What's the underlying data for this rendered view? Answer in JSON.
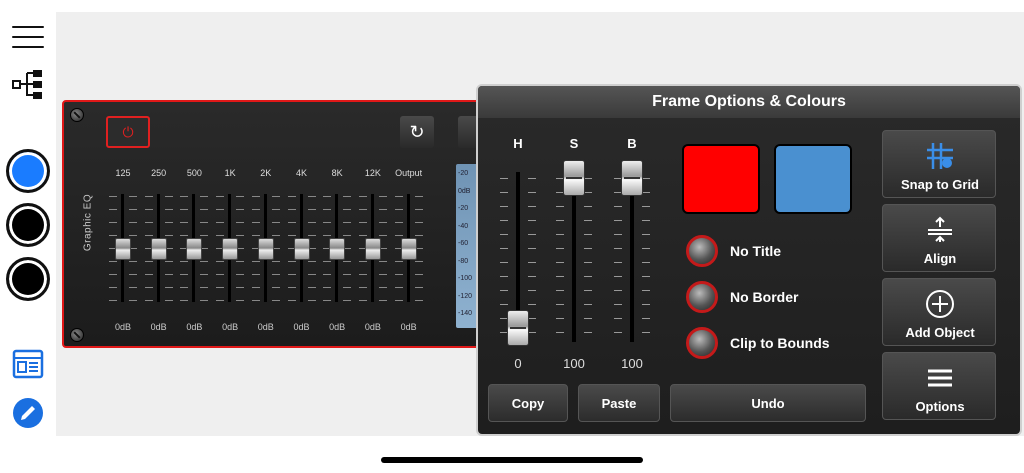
{
  "left_toolbar": {
    "items": [
      {
        "name": "menu-icon"
      },
      {
        "name": "hierarchy-icon"
      },
      {
        "name": "blue-color-swatch",
        "color": "#1a7cff"
      },
      {
        "name": "black-color-swatch-1",
        "color": "#000000"
      },
      {
        "name": "black-color-swatch-2",
        "color": "#000000"
      },
      {
        "name": "window-layout-icon"
      },
      {
        "name": "edit-pencil-icon"
      }
    ]
  },
  "eq": {
    "title": "Graphic EQ",
    "border_color": "#e01818",
    "bands": [
      {
        "label": "125",
        "value": "0dB"
      },
      {
        "label": "250",
        "value": "0dB"
      },
      {
        "label": "500",
        "value": "0dB"
      },
      {
        "label": "1K",
        "value": "0dB"
      },
      {
        "label": "2K",
        "value": "0dB"
      },
      {
        "label": "4K",
        "value": "0dB"
      },
      {
        "label": "8K",
        "value": "0dB"
      },
      {
        "label": "12K",
        "value": "0dB"
      },
      {
        "label": "Output",
        "value": "0dB"
      }
    ],
    "meter_labels": [
      "-20",
      "0dB",
      "-20",
      "-40",
      "-60",
      "-80",
      "-100",
      "-120",
      "-140"
    ]
  },
  "panel": {
    "title": "Frame Options & Colours",
    "sliders": [
      {
        "label": "H",
        "value": "0",
        "level": 0
      },
      {
        "label": "S",
        "value": "100",
        "level": 1
      },
      {
        "label": "B",
        "value": "100",
        "level": 1
      }
    ],
    "swatches": [
      {
        "name": "border-colour-swatch",
        "color": "#ff0000"
      },
      {
        "name": "background-colour-swatch",
        "color": "#4a90d0"
      }
    ],
    "options": [
      {
        "label": "No Title"
      },
      {
        "label": "No Border"
      },
      {
        "label": "Clip to Bounds"
      }
    ],
    "buttons": {
      "copy": "Copy",
      "paste": "Paste",
      "undo": "Undo"
    },
    "side_buttons": [
      {
        "label": "Snap to Grid",
        "icon": "grid-icon"
      },
      {
        "label": "Align",
        "icon": "align-icon"
      },
      {
        "label": "Add Object",
        "icon": "plus-circle-icon"
      },
      {
        "label": "Options",
        "icon": "menu-icon"
      }
    ]
  }
}
